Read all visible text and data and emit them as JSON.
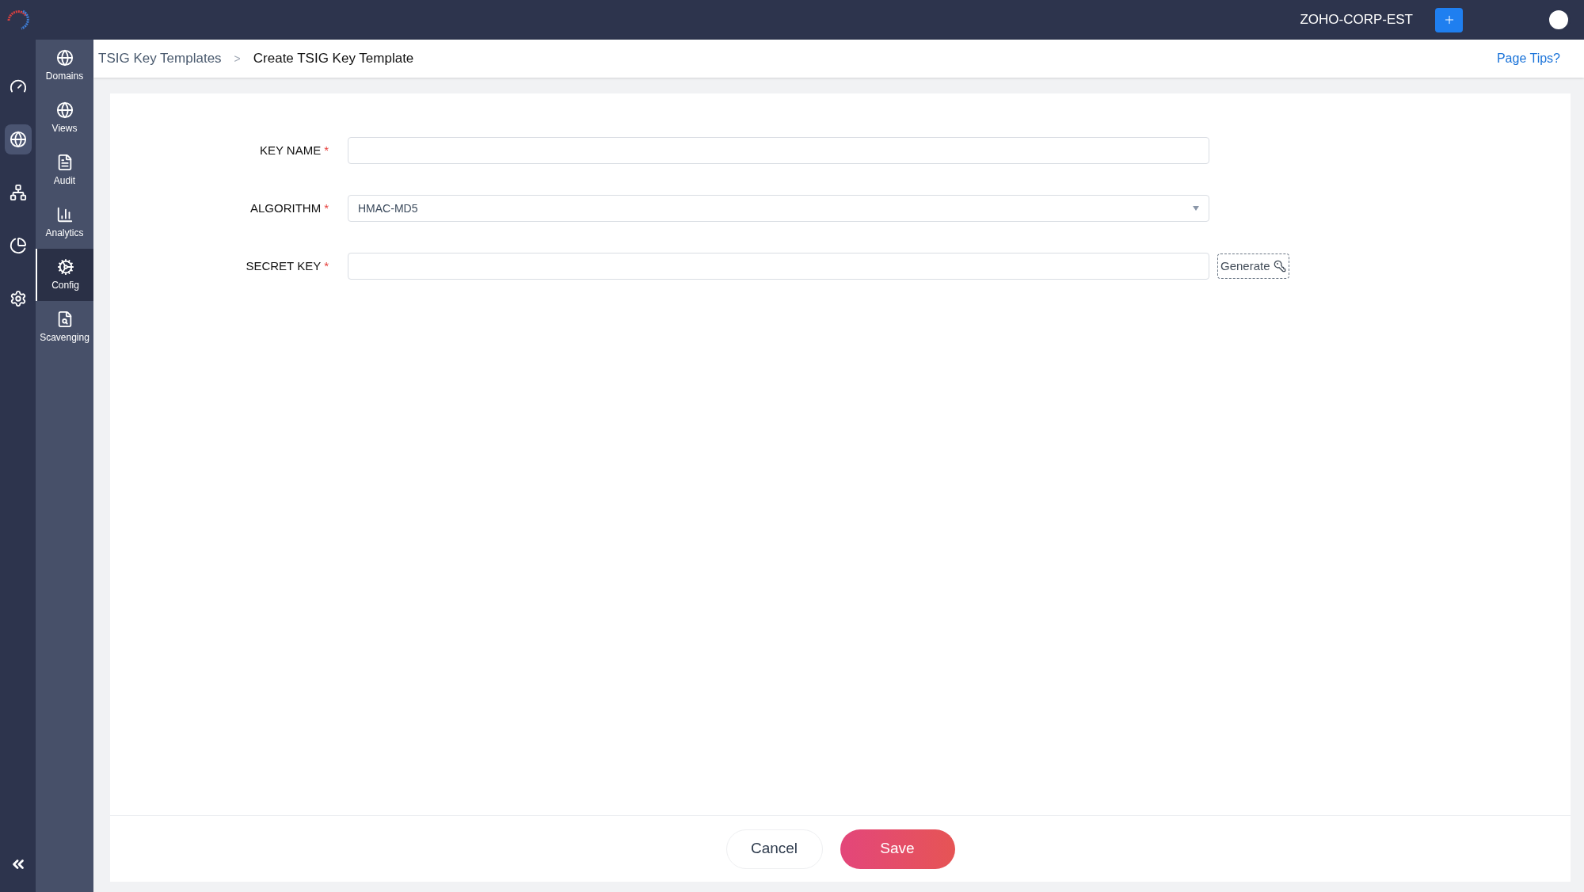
{
  "top_bar": {
    "org": "ZOHO-CORP-EST"
  },
  "rail": [
    {
      "selected": false
    },
    {
      "selected": true
    },
    {
      "selected": false
    },
    {
      "selected": false
    },
    {
      "selected": false
    }
  ],
  "nav": [
    {
      "label": "Domains",
      "selected": false
    },
    {
      "label": "Views",
      "selected": false
    },
    {
      "label": "Audit",
      "selected": false
    },
    {
      "label": "Analytics",
      "selected": false
    },
    {
      "label": "Config",
      "selected": true
    },
    {
      "label": "Scavenging",
      "selected": false
    }
  ],
  "breadcrumb": {
    "parent": "TSIG Key Templates",
    "separator": ">",
    "current": "Create TSIG Key Template"
  },
  "page_tips": "Page Tips?",
  "form": [
    {
      "kind": "text",
      "label": "KEY NAME",
      "required_mark": "*"
    },
    {
      "kind": "select",
      "label": "ALGORITHM",
      "required_mark": "*",
      "value": "HMAC-MD5"
    },
    {
      "kind": "text_button",
      "label": "SECRET KEY",
      "required_mark": "*",
      "button": "Generate"
    }
  ],
  "buttons": {
    "cancel": "Cancel",
    "save": "Save"
  }
}
